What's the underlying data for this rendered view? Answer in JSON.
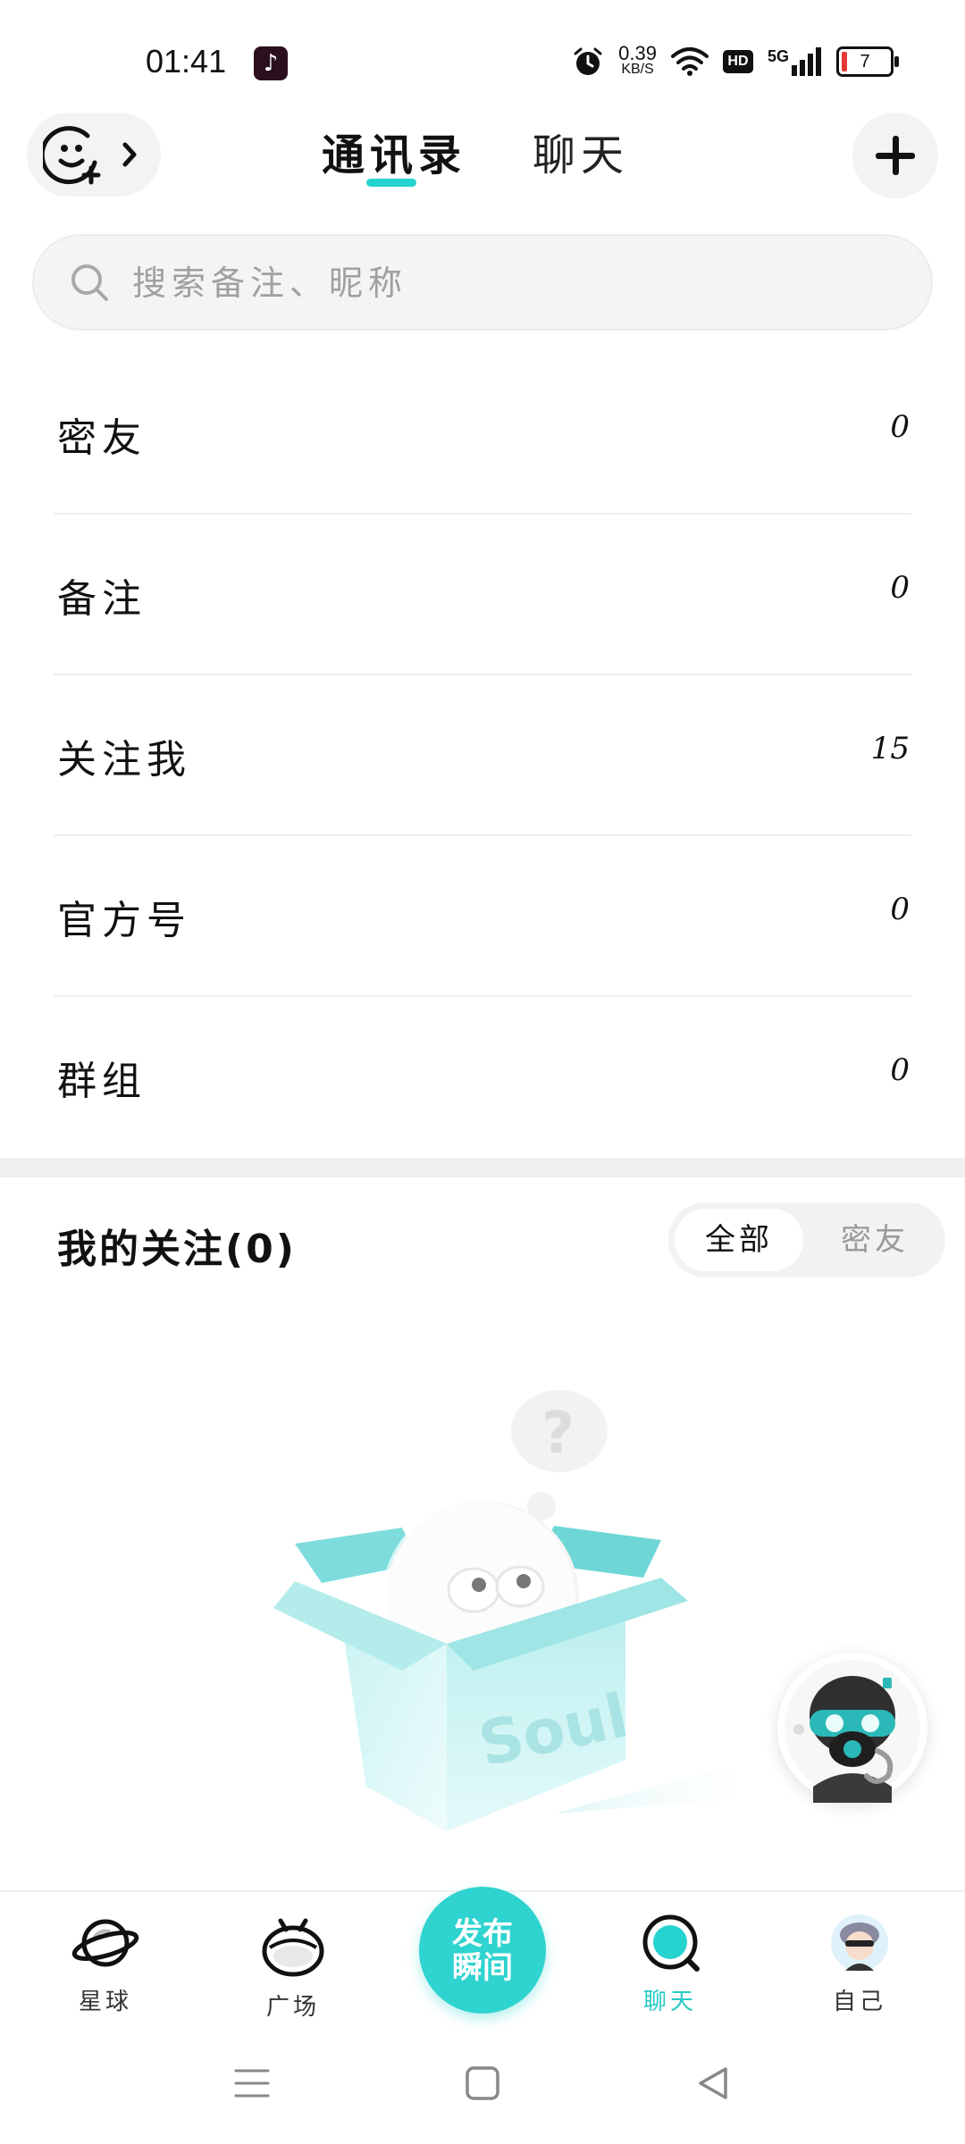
{
  "status_bar": {
    "time": "01:41",
    "speed_value": "0.39",
    "speed_unit": "KB/S",
    "hd": "HD",
    "signal": "5G",
    "battery": "7"
  },
  "header": {
    "tabs": [
      {
        "label": "通讯录",
        "active": true
      },
      {
        "label": "聊天",
        "active": false
      }
    ],
    "accent_color": "#25d4d0"
  },
  "search": {
    "placeholder": "搜索备注、昵称"
  },
  "categories": [
    {
      "label": "密友",
      "count": "0"
    },
    {
      "label": "备注",
      "count": "0"
    },
    {
      "label": "关注我",
      "count": "15"
    },
    {
      "label": "官方号",
      "count": "0"
    },
    {
      "label": "群组",
      "count": "0"
    }
  ],
  "following": {
    "title": "我的关注(0)",
    "filters": [
      {
        "label": "全部",
        "selected": true
      },
      {
        "label": "密友",
        "selected": false
      }
    ],
    "box_logo": "Soul"
  },
  "bottom_nav": {
    "items": [
      {
        "label": "星球",
        "icon": "planet-icon"
      },
      {
        "label": "广场",
        "icon": "square-icon"
      },
      {
        "label": "聊天",
        "icon": "chat-icon",
        "active": true
      },
      {
        "label": "自己",
        "icon": "avatar-icon"
      }
    ],
    "publish_line1": "发布",
    "publish_line2": "瞬间"
  }
}
